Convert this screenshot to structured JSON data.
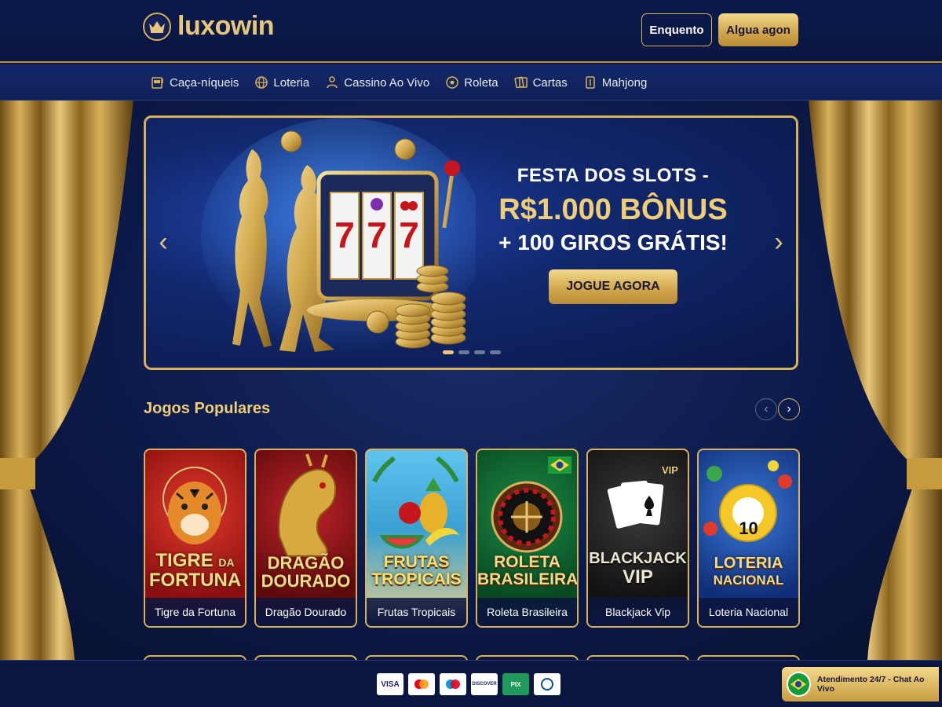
{
  "header": {
    "brand": "luxowin",
    "login_label": "Enquento",
    "register_label": "Algua agon"
  },
  "nav": {
    "items": [
      {
        "label": "Caça-níqueis",
        "icon": "slot-machine-icon"
      },
      {
        "label": "Loteria",
        "icon": "globe-icon"
      },
      {
        "label": "Cassino Ao Vivo",
        "icon": "dealer-icon"
      },
      {
        "label": "Roleta",
        "icon": "roulette-icon"
      },
      {
        "label": "Cartas",
        "icon": "cards-icon"
      },
      {
        "label": "Mahjong",
        "icon": "mahjong-tile-icon"
      }
    ]
  },
  "banner": {
    "line1": "FESTA DOS SLOTS -",
    "line2": "R$1.000 BÔNUS",
    "line3": "+ 100 GIROS GRÁTIS!",
    "cta": "JOGUE AGORA",
    "slide_count": 4,
    "active_slide": 0
  },
  "popular": {
    "title": "Jogos Populares",
    "games": [
      {
        "art_line1": "TIGRE",
        "art_line2": "DA",
        "art_line3": "FORTUNA",
        "caption": "Tigre da Fortuna",
        "theme": "#a3161a"
      },
      {
        "art_line1": "DRAGÃO",
        "art_line2": "",
        "art_line3": "DOURADO",
        "caption": "Dragão Dourado",
        "theme": "#8a1012"
      },
      {
        "art_line1": "FRUTAS",
        "art_line2": "",
        "art_line3": "TROPICAIS",
        "caption": "Frutas Tropicais",
        "theme": "#1f8fbf"
      },
      {
        "art_line1": "ROLETA",
        "art_line2": "",
        "art_line3": "BRASILEIRA",
        "caption": "Roleta Brasileira",
        "theme": "#0e6b2f"
      },
      {
        "art_line1": "BLACKJACK",
        "art_line2": "",
        "art_line3": "VIP",
        "caption": "Blackjack Vip",
        "theme": "#1c1c1c",
        "badge": "VIP"
      },
      {
        "art_line1": "LOTERIA",
        "art_line2": "",
        "art_line3": "NACIONAL",
        "caption": "Loteria Nacional",
        "theme": "#1a4fa8",
        "ball_number": "10"
      }
    ]
  },
  "footer": {
    "payments": [
      "VISA",
      "mastercard",
      "maestro",
      "DISCOVER",
      "PIX",
      "Diners Club"
    ],
    "support_text": "Atendimento 24/7 - Chat Ao Vivo"
  }
}
